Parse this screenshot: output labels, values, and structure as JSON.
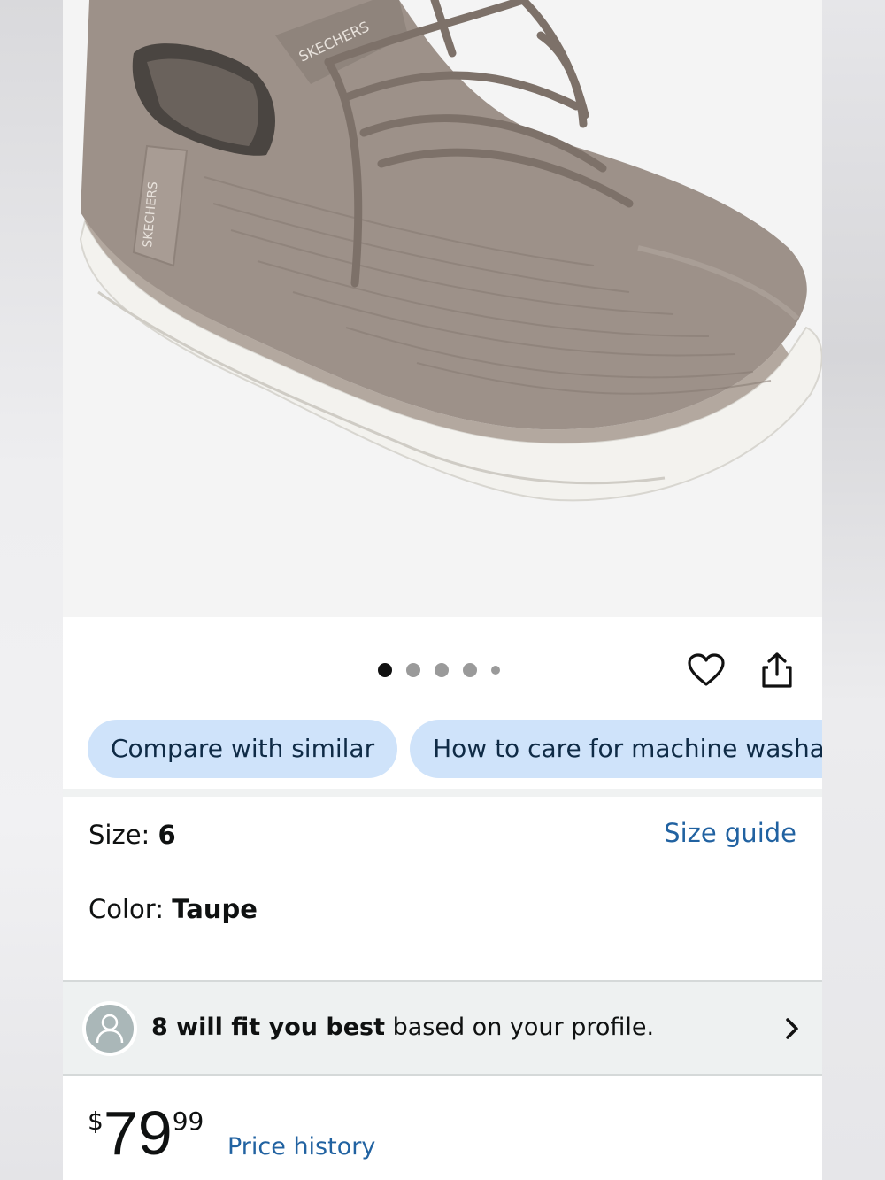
{
  "gallery": {
    "image_alt": "Skechers taupe knit slip-on sneaker",
    "brand_text": "SKECHERS",
    "dot_count": 5,
    "active_index": 0
  },
  "actions": {
    "favorite_icon": "heart-icon",
    "share_icon": "share-icon"
  },
  "chips": [
    {
      "label": "Compare with similar"
    },
    {
      "label": "How to care for machine washabl"
    }
  ],
  "size": {
    "label": "Size: ",
    "value": "6",
    "guide_link": "Size guide"
  },
  "color": {
    "label": "Color: ",
    "value": "Taupe"
  },
  "fit": {
    "bold": "8 will fit you best",
    "rest": " based on your profile.",
    "icon": "user-icon",
    "arrow_icon": "chevron-right-icon"
  },
  "price": {
    "symbol": "$",
    "whole": "79",
    "fraction": "99",
    "history_link": "Price history"
  },
  "colors": {
    "link": "#2162a1",
    "chip_bg": "#cfe3fa",
    "shoe_knit": "#9c8f87",
    "sole": "#f4f4f1"
  }
}
